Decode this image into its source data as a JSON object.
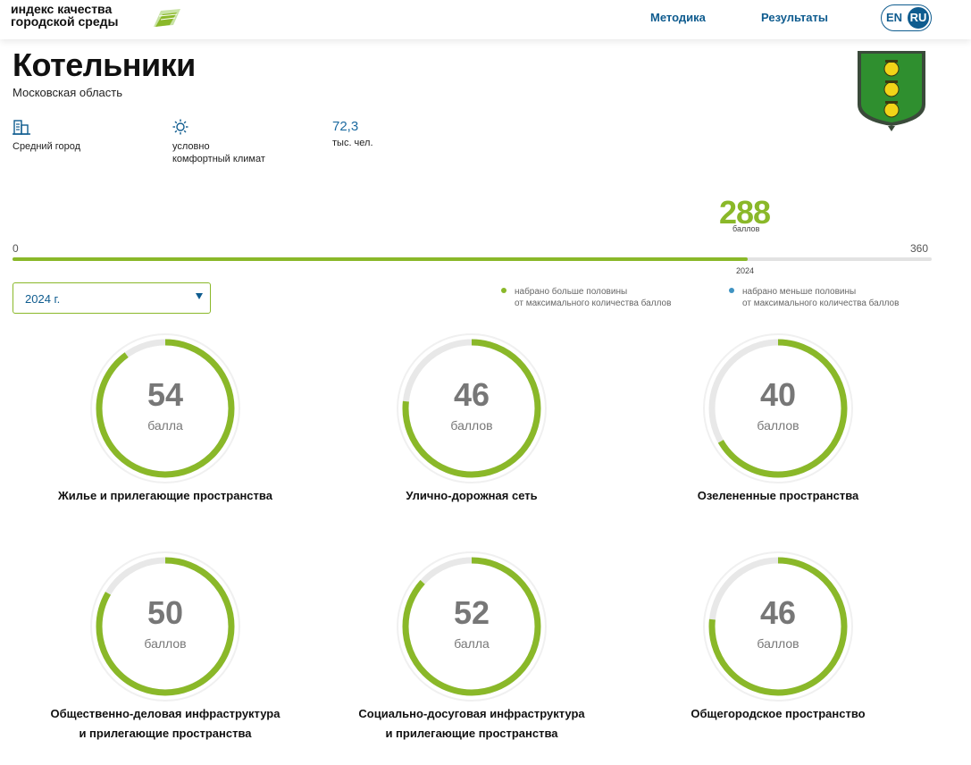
{
  "header": {
    "logo_line1": "индекс качества",
    "logo_line2": "городской среды",
    "nav": [
      "Методика",
      "Результаты"
    ],
    "lang": {
      "en": "EN",
      "ru": "RU",
      "active": "RU"
    }
  },
  "city": {
    "name": "Котельники",
    "region": "Московская область",
    "size_label": "Средний город",
    "climate_line1": "условно",
    "climate_line2": "комфортный климат",
    "population_value": "72,3",
    "population_unit": "тыс. чел."
  },
  "score": {
    "value": "288",
    "value_number": 288,
    "unit": "баллов",
    "min": "0",
    "max": "360",
    "max_number": 360,
    "year_marker": "2024"
  },
  "year_select": {
    "value": "2024 г."
  },
  "legend": {
    "above": {
      "line1": "набрано больше половины",
      "line2": "от максимального количества баллов",
      "color": "#8ab829"
    },
    "below": {
      "line1": "набрано меньше половины",
      "line2": "от максимального количества баллов",
      "color": "#3f93c2"
    }
  },
  "colors": {
    "accent_green": "#8ab829",
    "accent_blue": "#0f5c8f",
    "track": "#e8e8e8"
  },
  "categories": [
    {
      "value": "54",
      "value_number": 54,
      "max": 60,
      "unit": "балла",
      "line1": "Жилье и прилегающие пространства",
      "line2": ""
    },
    {
      "value": "46",
      "value_number": 46,
      "max": 60,
      "unit": "баллов",
      "line1": "Улично-дорожная сеть",
      "line2": ""
    },
    {
      "value": "40",
      "value_number": 40,
      "max": 60,
      "unit": "баллов",
      "line1": "Озелененные пространства",
      "line2": ""
    },
    {
      "value": "50",
      "value_number": 50,
      "max": 60,
      "unit": "баллов",
      "line1": "Общественно-деловая инфраструктура",
      "line2": "и прилегающие пространства"
    },
    {
      "value": "52",
      "value_number": 52,
      "max": 60,
      "unit": "балла",
      "line1": "Социально-досуговая инфраструктура",
      "line2": "и прилегающие пространства"
    },
    {
      "value": "46",
      "value_number": 46,
      "max": 60,
      "unit": "баллов",
      "line1": "Общегородское пространство",
      "line2": ""
    }
  ]
}
